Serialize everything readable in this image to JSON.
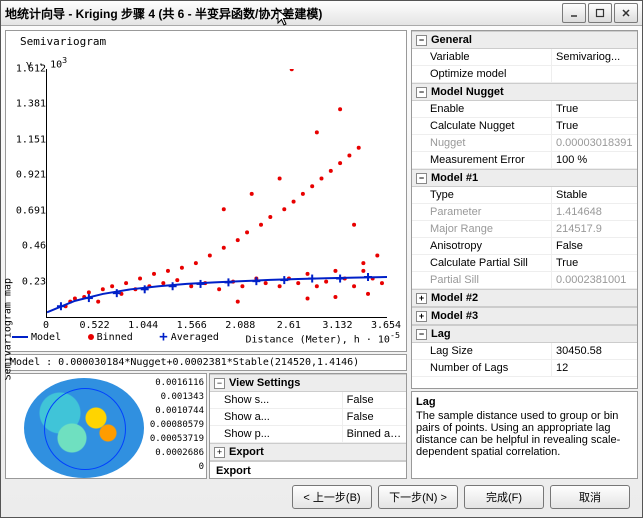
{
  "window": {
    "title": "地统计向导 - Kriging 步骤 4 (共 6 - 半变异函数/协方差建模)"
  },
  "chart": {
    "title": "Semivariogram",
    "yaxis_html": "γ · 10<sup>3</sup>",
    "xaxis_html": "Distance (Meter), h · 10<sup>-5</sup>",
    "yticks": [
      "1.612",
      "1.381",
      "1.151",
      "0.921",
      "0.691",
      "0.46",
      "0.23"
    ],
    "xticks": [
      "0",
      "0.522",
      "1.044",
      "1.566",
      "2.088",
      "2.61",
      "3.132",
      "3.654"
    ],
    "legend": {
      "model": "Model",
      "binned": "Binned",
      "averaged": "Averaged"
    }
  },
  "formula": "Model : 0.000030184*Nugget+0.0002381*Stable(214520,1.4146)",
  "map": {
    "label": "Semivariogram map",
    "legend": [
      "0.0016116",
      "0.001343",
      "0.0010744",
      "0.00080579",
      "0.00053719",
      "0.0002686",
      "0"
    ]
  },
  "viewSettings": {
    "header": "View Settings",
    "rows": [
      {
        "k": "Show s...",
        "v": "False"
      },
      {
        "k": "Show a...",
        "v": "False"
      },
      {
        "k": "Show p...",
        "v": "Binned and..."
      }
    ],
    "exportHeader": "Export",
    "exportLabel": "Export"
  },
  "props": {
    "general": {
      "header": "General",
      "rows": [
        {
          "k": "Variable",
          "v": "Semivariog..."
        },
        {
          "k": "Optimize model",
          "v": ""
        }
      ]
    },
    "nugget": {
      "header": "Model Nugget",
      "rows": [
        {
          "k": "Enable",
          "v": "True"
        },
        {
          "k": "Calculate Nugget",
          "v": "True"
        },
        {
          "k": "Nugget",
          "v": "0.00003018391",
          "dim": true
        },
        {
          "k": "Measurement Error",
          "v": "100    %"
        }
      ]
    },
    "model1": {
      "header": "Model #1",
      "rows": [
        {
          "k": "Type",
          "v": "Stable"
        },
        {
          "k": "Parameter",
          "v": "1.414648",
          "dim": true
        },
        {
          "k": "Major Range",
          "v": "214517.9",
          "dim": true
        },
        {
          "k": "Anisotropy",
          "v": "False"
        },
        {
          "k": "Calculate Partial Sill",
          "v": "True"
        },
        {
          "k": "Partial Sill",
          "v": "0.0002381001",
          "dim": true
        }
      ]
    },
    "model2": {
      "header": "Model #2"
    },
    "model3": {
      "header": "Model #3"
    },
    "lag": {
      "header": "Lag",
      "rows": [
        {
          "k": "Lag Size",
          "v": "30450.58"
        },
        {
          "k": "Number of Lags",
          "v": "12"
        }
      ]
    }
  },
  "desc": {
    "title": "Lag",
    "body": "The sample distance used to group or bin pairs of points. Using an appropriate lag distance can be helpful in revealing scale-dependent spatial correlation."
  },
  "buttons": {
    "back": "< 上一步(B)",
    "next": "下一步(N) >",
    "finish": "完成(F)",
    "cancel": "取消"
  },
  "chart_data": {
    "type": "scatter+line",
    "title": "Semivariogram",
    "xlabel": "Distance (Meter), h · 10^-5",
    "ylabel": "γ · 10^3",
    "xlim": [
      0,
      3.654
    ],
    "ylim": [
      0,
      1.612
    ],
    "series": [
      {
        "name": "Binned",
        "type": "scatter",
        "color": "#e80000",
        "x": [
          0.2,
          0.25,
          0.3,
          0.4,
          0.45,
          0.55,
          0.6,
          0.7,
          0.8,
          0.85,
          0.95,
          1.0,
          1.1,
          1.15,
          1.25,
          1.3,
          1.4,
          1.45,
          1.55,
          1.6,
          1.7,
          1.75,
          1.85,
          1.9,
          2.0,
          2.05,
          2.1,
          2.15,
          2.25,
          2.3,
          2.35,
          2.4,
          2.5,
          2.55,
          2.6,
          2.65,
          2.7,
          2.75,
          2.8,
          2.85,
          2.9,
          2.95,
          3.0,
          3.05,
          3.1,
          3.15,
          3.2,
          3.25,
          3.3,
          3.35,
          3.4,
          3.45,
          3.5,
          3.55,
          3.6,
          2.63,
          2.9,
          3.15,
          3.3,
          3.1,
          3.4,
          2.8,
          2.5,
          2.2,
          1.9,
          2.05
        ],
        "y": [
          0.07,
          0.1,
          0.12,
          0.13,
          0.16,
          0.1,
          0.18,
          0.2,
          0.15,
          0.22,
          0.18,
          0.25,
          0.2,
          0.28,
          0.22,
          0.3,
          0.24,
          0.32,
          0.2,
          0.35,
          0.22,
          0.4,
          0.18,
          0.45,
          0.23,
          0.5,
          0.2,
          0.55,
          0.25,
          0.6,
          0.22,
          0.65,
          0.2,
          0.7,
          0.25,
          0.75,
          0.22,
          0.8,
          0.28,
          0.85,
          0.2,
          0.9,
          0.23,
          0.95,
          0.3,
          1.0,
          0.25,
          1.05,
          0.2,
          1.1,
          0.3,
          0.15,
          0.25,
          0.4,
          0.22,
          1.61,
          1.2,
          1.35,
          0.6,
          0.13,
          0.35,
          0.12,
          0.9,
          0.8,
          0.7,
          0.1
        ]
      },
      {
        "name": "Averaged",
        "type": "scatter",
        "marker": "+",
        "color": "#0020c8",
        "x": [
          0.15,
          0.45,
          0.75,
          1.05,
          1.35,
          1.65,
          1.95,
          2.25,
          2.55,
          2.85,
          3.15,
          3.45
        ],
        "y": [
          0.07,
          0.123,
          0.155,
          0.18,
          0.2,
          0.215,
          0.225,
          0.233,
          0.24,
          0.25,
          0.25,
          0.26
        ]
      },
      {
        "name": "Model",
        "type": "line",
        "color": "#0020c8",
        "x": [
          0,
          0.3,
          0.6,
          0.9,
          1.2,
          1.5,
          1.8,
          2.1,
          2.4,
          2.7,
          3.0,
          3.3,
          3.654
        ],
        "y": [
          0.03,
          0.105,
          0.15,
          0.18,
          0.2,
          0.215,
          0.225,
          0.233,
          0.241,
          0.247,
          0.252,
          0.256,
          0.26
        ]
      }
    ]
  }
}
